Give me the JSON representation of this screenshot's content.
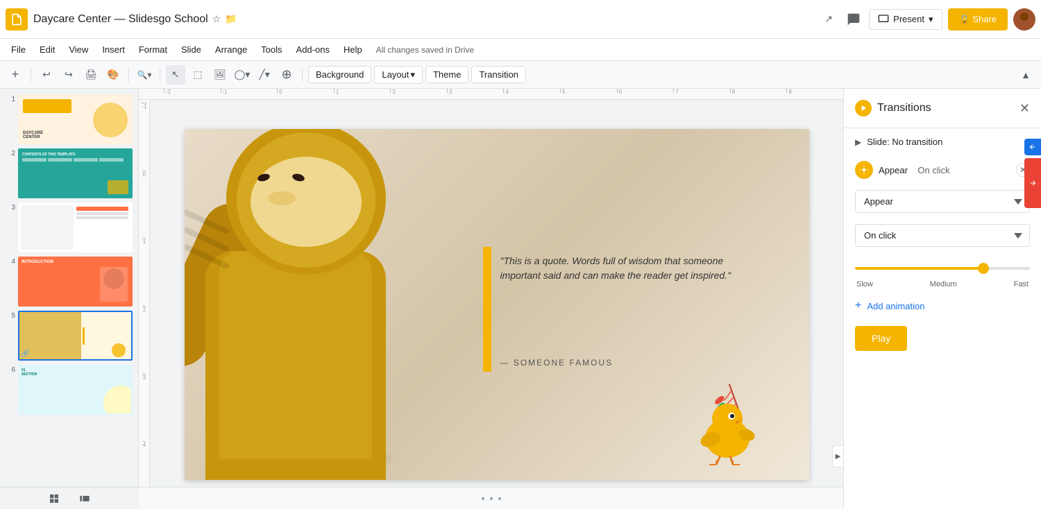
{
  "app": {
    "logo_color": "#F4B400",
    "doc_title": "Daycare Center — Slidesgo School",
    "star_icon": "☆",
    "folder_icon": "📁",
    "trend_icon": "↗",
    "chat_icon": "💬",
    "present_label": "Present",
    "share_label": "🔒 Share",
    "avatar_bg": "#a0522d"
  },
  "menu": {
    "items": [
      "File",
      "Edit",
      "View",
      "Insert",
      "Format",
      "Slide",
      "Arrange",
      "Tools",
      "Add-ons",
      "Help",
      "All changes saved in Drive"
    ]
  },
  "toolbar": {
    "background_label": "Background",
    "layout_label": "Layout",
    "theme_label": "Theme",
    "transition_label": "Transition"
  },
  "slide_panel": {
    "slides": [
      {
        "num": "1",
        "type": "daycare"
      },
      {
        "num": "2",
        "type": "teal"
      },
      {
        "num": "3",
        "type": "white"
      },
      {
        "num": "4",
        "type": "orange"
      },
      {
        "num": "5",
        "type": "yellow"
      },
      {
        "num": "6",
        "type": "cyan"
      }
    ]
  },
  "slide_content": {
    "quote": "\"This is a quote. Words full of wisdom that someone important said and can make the reader get inspired.\"",
    "author": "— SOMEONE FAMOUS"
  },
  "transitions_panel": {
    "title": "Transitions",
    "slide_transition": "Slide: No transition",
    "animation_label": "Appear  (On click)",
    "appear_dropdown": "Appear",
    "on_click_dropdown": "On click",
    "speed_slow": "Slow",
    "speed_medium": "Medium",
    "speed_fast": "Fast",
    "speed_value": 75,
    "add_animation_label": "Add animation",
    "play_label": "Play"
  },
  "ruler": {
    "h_marks": [
      "-2",
      "-1",
      "0",
      "1",
      "2",
      "3",
      "4",
      "5",
      "6",
      "7",
      "8",
      "9"
    ],
    "v_marks": [
      "-1",
      "0",
      "1",
      "2",
      "3",
      "4"
    ]
  },
  "bottom_dots": [
    "•",
    "•",
    "•"
  ],
  "side_panel_icons": {
    "blue": "#1a73e8",
    "red": "#ea4335"
  }
}
